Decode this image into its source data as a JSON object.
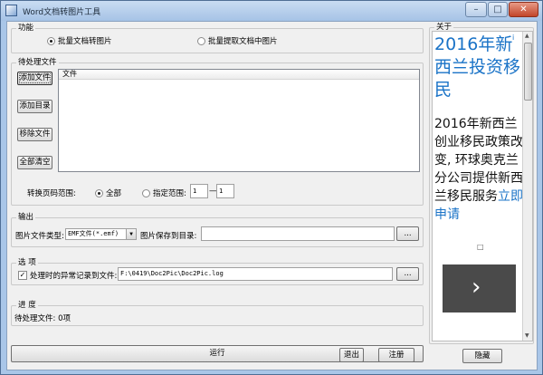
{
  "window": {
    "title": "Word文档转图片工具",
    "minimize": "–",
    "maximize": "□",
    "close": "✕"
  },
  "function_group": {
    "label": "功能",
    "options": [
      {
        "label": "批量文档转图片",
        "selected": true
      },
      {
        "label": "批量提取文档中图片",
        "selected": false
      }
    ]
  },
  "pending_group": {
    "label": "待处理文件",
    "buttons": {
      "add_file": "添加文件",
      "add_dir": "添加目录",
      "remove_file": "移除文件",
      "clear_all": "全部清空"
    },
    "list": {
      "column_header": "文件",
      "rows": []
    },
    "page_range": {
      "label": "转换页码范围:",
      "all_label": "全部",
      "range_label": "指定范围:",
      "from": "1",
      "dash": "—",
      "to": "1",
      "all_selected": true
    }
  },
  "output_group": {
    "label": "输出",
    "type_label": "图片文件类型:",
    "type_value": "EMF文件(*.emf)",
    "dir_label": "图片保存到目录:",
    "dir_value": "",
    "browse": "..."
  },
  "options_group": {
    "label": "选  项",
    "log_checkbox": "处理时的异常记录到文件:",
    "log_checked": true,
    "log_path": "F:\\0419\\Doc2Pic\\Doc2Pic.log",
    "browse": "..."
  },
  "progress_group": {
    "label": "进  度",
    "status": "待处理文件: 0项"
  },
  "footer": {
    "run": "运行",
    "exit": "退出",
    "register": "注册",
    "hide": "隐藏"
  },
  "about": {
    "label": "关于",
    "ad_headline": "2016年新西兰投资移民",
    "ad_body": "2016年新西兰创业移民政策改变, 环球奥克兰分公司提供新西兰移民服务",
    "ad_link": "立即申请",
    "ad_marker": "□",
    "ad_corner_icon": "i",
    "ad_next_icon": "›"
  }
}
